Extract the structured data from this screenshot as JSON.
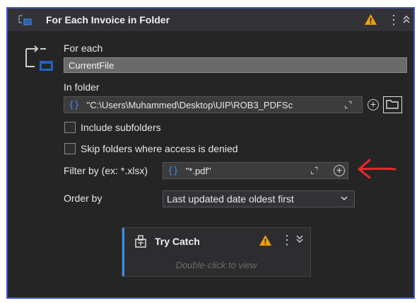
{
  "header": {
    "title": "For Each Invoice in Folder"
  },
  "for_each": {
    "label": "For each",
    "value": "CurrentFile"
  },
  "in_folder": {
    "label": "In folder",
    "value": "\"C:\\Users\\Muhammed\\Desktop\\UIP\\ROB3_PDFSc"
  },
  "checkboxes": {
    "include_subfolders": "Include subfolders",
    "skip_denied": "Skip folders where access is denied"
  },
  "filter": {
    "label": "Filter by (ex: *.xlsx)",
    "value": "\"*.pdf\""
  },
  "order_by": {
    "label": "Order by",
    "selected": "Last updated date oldest first"
  },
  "try_catch": {
    "title": "Try Catch",
    "hint": "Double-click to view"
  },
  "colors": {
    "accent": "#3b8eea",
    "border": "#3f55c8",
    "warning": "#f0a30a",
    "annotation_arrow": "#e52b2b"
  },
  "icons": [
    "foreach-activity-icon",
    "warning-icon",
    "more-icon",
    "collapse-icon",
    "braces-icon",
    "expand-icon",
    "add-icon",
    "folder-icon",
    "trycatch-icon",
    "chevron-down-icon",
    "red-arrow-annotation"
  ]
}
